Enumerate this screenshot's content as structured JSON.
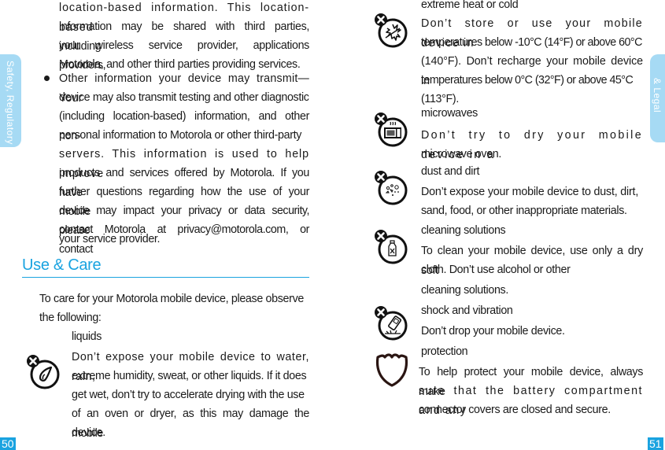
{
  "left_page": {
    "side_tab": "Safety, Regulatory",
    "page_number": "50",
    "continued_lines": [
      "location-based information. This location-based",
      "information may be shared with third parties, including",
      "your wireless service provider, applications providers,",
      "Motorola, and other third parties providing services."
    ],
    "bullet_lines": [
      "Other information your device may transmit—Your",
      "device may also transmit testing and other diagnostic",
      "(including location-based) information, and other non-",
      "personal information to Motorola or other third-party",
      "servers. This information is used to help improve",
      "products and services offered by Motorola. If you have",
      "further questions regarding how the use of your mobile",
      "device may impact your privacy or data security, please",
      "contact Motorola at privacy@motorola.com, or contact",
      "your service provider."
    ],
    "section_heading": "Use & Care",
    "intro_lines": [
      "To care for your Motorola mobile device, please observe",
      "the following:"
    ],
    "items": [
      {
        "icon": "liquid-drop-prohibited-icon",
        "title": "liquids",
        "lines": [
          "Don’t expose your mobile device to water, rain,",
          "extreme humidity, sweat, or other liquids. If it does",
          "get wet, don’t try to accelerate drying with the use",
          "of an oven or dryer, as this may damage the mobile",
          "device."
        ]
      }
    ]
  },
  "right_page": {
    "side_tab": "& Legal",
    "page_number": "51",
    "items": [
      {
        "icon": "heat-cold-prohibited-icon",
        "title": "extreme heat or cold",
        "lines": [
          "Don’t store or use your mobile device in",
          "temperatures below -10°C (14°F) or above 60°C",
          "(140°F). Don’t recharge your mobile device in",
          "temperatures below 0°C (32°F) or above 45°C",
          "(113°F)."
        ]
      },
      {
        "icon": "microwave-prohibited-icon",
        "title": "microwaves",
        "lines": [
          "Don’t try to dry your mobile device in a",
          "microwave oven."
        ]
      },
      {
        "icon": "dust-prohibited-icon",
        "title": "dust and dirt",
        "lines": [
          "Don’t expose your mobile device to dust, dirt,",
          "sand, food, or other inappropriate materials."
        ]
      },
      {
        "icon": "cleaning-solution-prohibited-icon",
        "title": "cleaning solutions",
        "lines": [
          "To clean your mobile device, use only a dry soft",
          "cloth. Don’t use alcohol or other",
          "cleaning solutions."
        ]
      },
      {
        "icon": "drop-shock-prohibited-icon",
        "title": "shock and vibration",
        "lines": [
          "Don’t drop your mobile device."
        ]
      },
      {
        "icon": "shield-protection-icon",
        "title": "protection",
        "lines": [
          "To help protect your mobile device, always make",
          "sure that the battery compartment and any",
          "connector covers are closed and secure."
        ]
      }
    ]
  },
  "colors": {
    "accent": "#1aa3e0",
    "side_tab": "#a6daf4",
    "text": "#1a1a1a"
  }
}
